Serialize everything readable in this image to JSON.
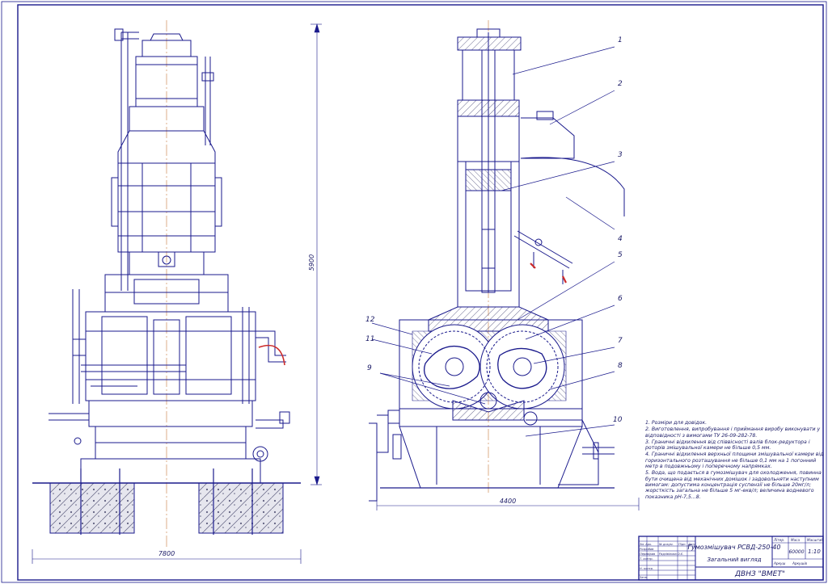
{
  "drawing": {
    "title": "Гумозмішувач РСВД-250-40",
    "subtitle": "Загальний вигляд",
    "organization": "ДВНЗ \"ВМЕТ\"",
    "scale": "1:10",
    "mass": "60000",
    "stamp_headers": {
      "litera": "Літер.",
      "mass": "Маса",
      "scale": "Масштаб",
      "sheet": "Аркуш",
      "sheets": "Аркушів",
      "change": "Зм. Арк.",
      "doc_no": "№ докум.",
      "sign": "Підп.",
      "date": "Дата",
      "developed": "Розробив",
      "checked": "Перевірив",
      "t_control": "Т. контр.",
      "n_control": "Н. контр.",
      "approved": "Затв."
    },
    "checker_name": "Радзівілова О.Є."
  },
  "dimensions": {
    "height": "5900",
    "width_front": "7800",
    "width_side": "4400"
  },
  "callouts": [
    "1",
    "2",
    "3",
    "4",
    "5",
    "6",
    "7",
    "8",
    "9",
    "10",
    "11",
    "12"
  ],
  "notes": [
    "1. Розміри для довідок.",
    "2. Виготовлення, випробування і приймання виробу виконувати у відповідності з вимогами ТУ 26-09-282-78.",
    "3. Граничні відхилення від співвісності валів блок-редуктора і роторів змішувальної камери не більше 0,5 мм.",
    "4. Граничні відхилення верхньої площини змішувальної камери від горизонтального розташування не більше 0,1 мм на 1 погонний метр в подовжньому і поперечному напрямках.",
    "5. Вода, що подається в гумозмішувач для охолодження, повинна бути очищена від механічних домішок і задовольняти наступним вимогам: допустима концентрація суспензії не більше 20мг/л; жорсткість загальна не більше 5 мг-екв/л; величина водневого показника pH-7,5...8."
  ],
  "colors": {
    "line": "#1a1a8c",
    "center": "#c87a3a",
    "hatch": "#404070",
    "accent": "#cc2a2a",
    "background": "#ffffff"
  }
}
